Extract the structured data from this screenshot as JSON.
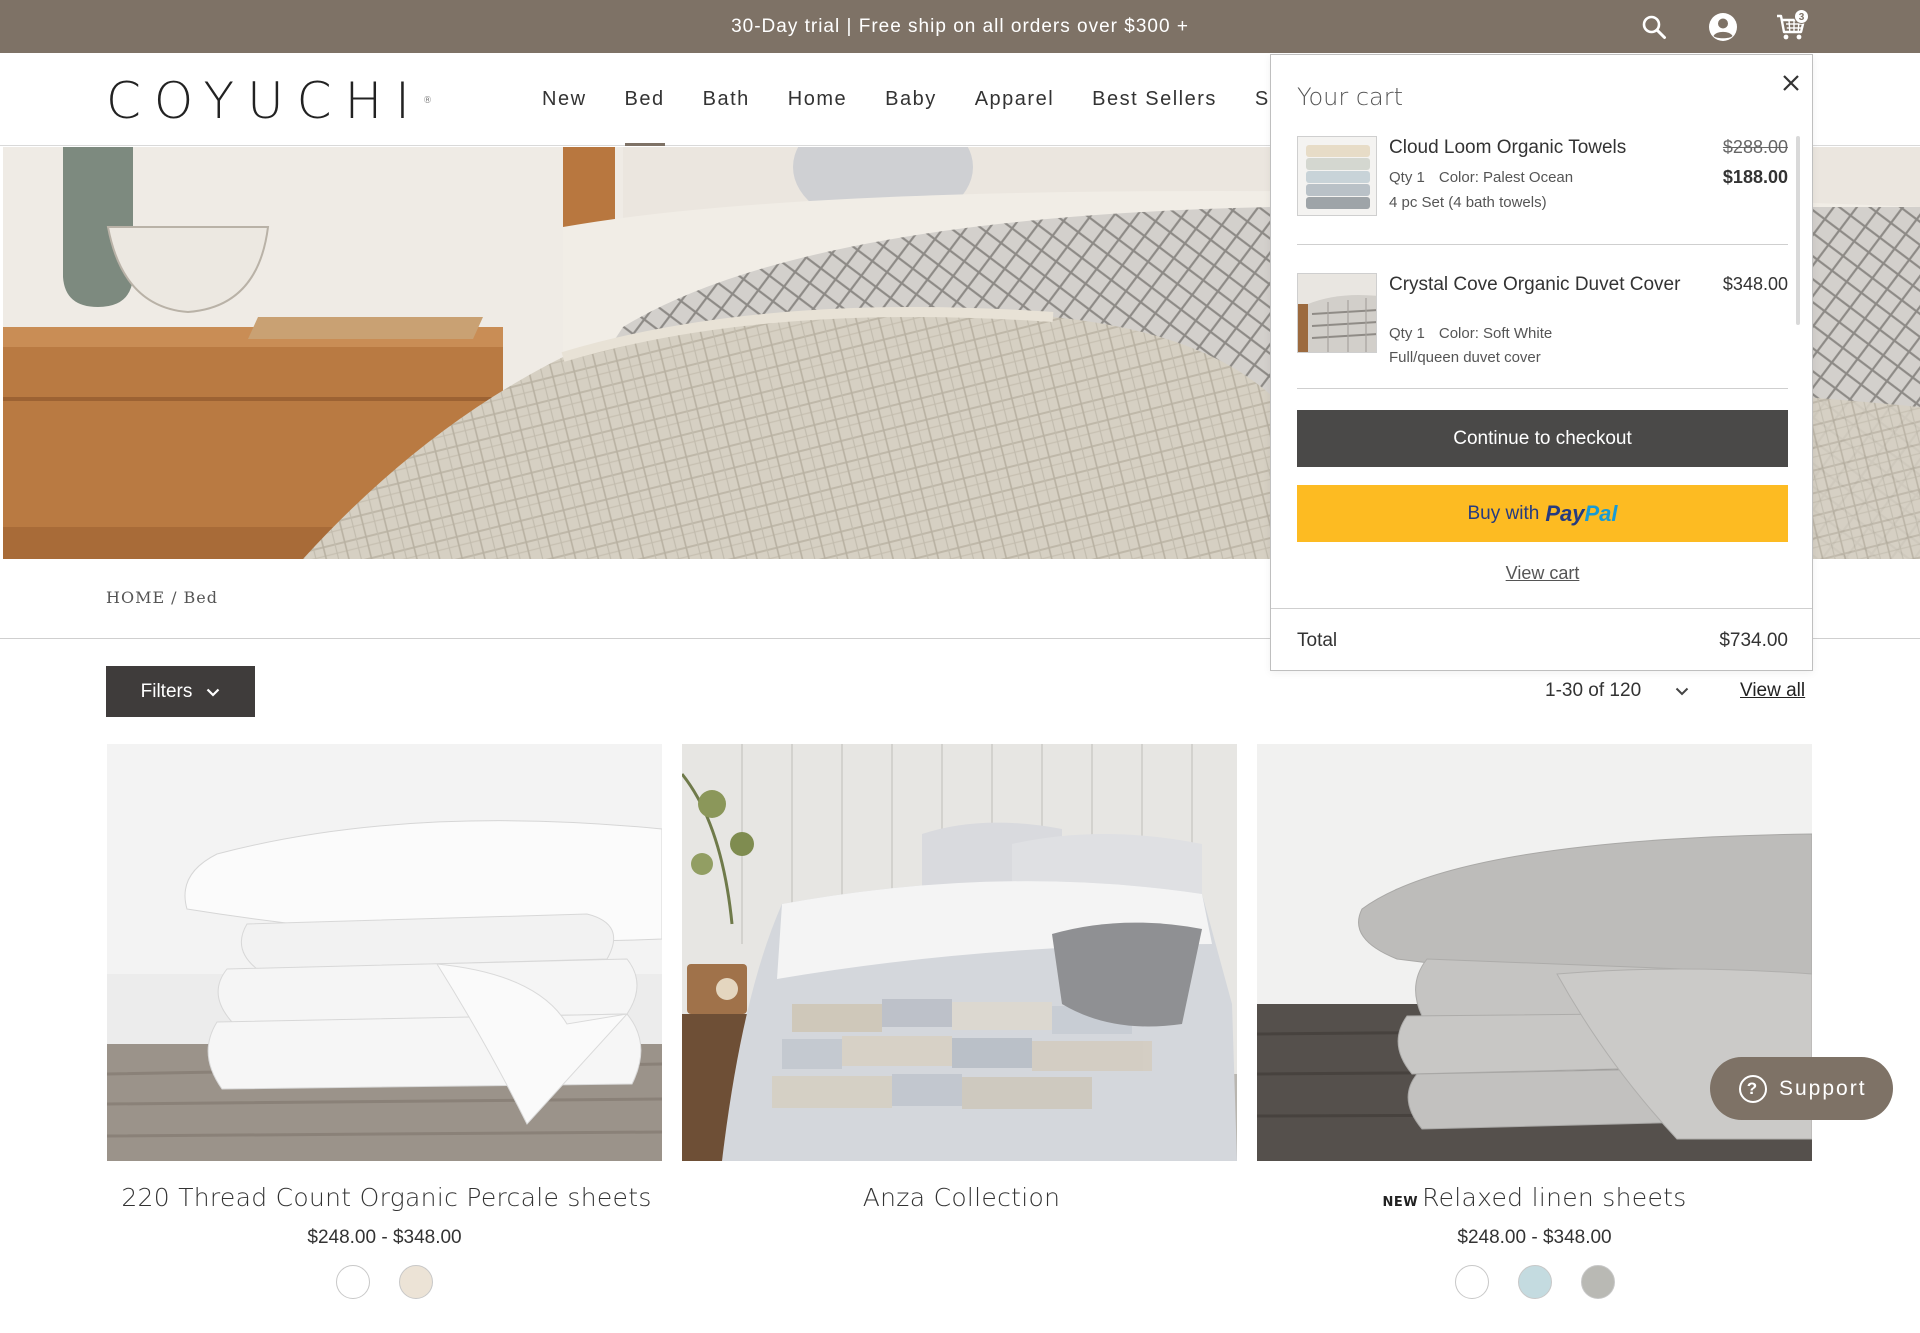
{
  "promo": {
    "text": "30-Day trial | Free ship on all orders over $300 +",
    "cart_count": "3",
    "background": "#7e7266"
  },
  "icons": {
    "search": "search-icon",
    "account": "account-icon",
    "cart": "cart-icon",
    "close": "close-icon",
    "chevron": "chevron-down-icon",
    "help": "help-icon"
  },
  "header": {
    "logo": "COYUCHI",
    "logo_mark": "®",
    "nav": [
      {
        "label": "New"
      },
      {
        "label": "Bed"
      },
      {
        "label": "Bath"
      },
      {
        "label": "Home"
      },
      {
        "label": "Baby"
      },
      {
        "label": "Apparel"
      },
      {
        "label": "Best Sellers"
      },
      {
        "label": "Sa"
      }
    ],
    "active_nav": "Bed"
  },
  "breadcrumb": {
    "home": "HOME",
    "sep": "/",
    "current": "Bed"
  },
  "toolbar": {
    "filters": "Filters",
    "pagination": "1-30 of 120",
    "view_all": "View all"
  },
  "products": [
    {
      "name": "220 Thread Count Organic Percale sheets",
      "badge": "",
      "price": "$248.00 - $348.00",
      "swatches": [
        "#ffffff",
        "#ece3d6"
      ]
    },
    {
      "name": "Anza Collection",
      "badge": "",
      "price": "",
      "swatches": []
    },
    {
      "name": "Relaxed linen sheets",
      "badge": "NEW",
      "price": "$248.00 - $348.00",
      "swatches": [
        "#ffffff",
        "#c4dbe0",
        "#b9b9b4"
      ]
    }
  ],
  "cart": {
    "title": "Your cart",
    "items": [
      {
        "name": "Cloud Loom Organic Towels",
        "qty": "Qty 1",
        "color": "Color: Palest Ocean",
        "variant": "4 pc Set (4 bath towels)",
        "price_old": "$288.00",
        "price": "$188.00"
      },
      {
        "name": "Crystal Cove Organic Duvet Cover",
        "qty": "Qty 1",
        "color": "Color: Soft White",
        "variant": "Full/queen duvet cover",
        "price": "$348.00"
      }
    ],
    "checkout": "Continue to checkout",
    "paypal_prefix": "Buy with",
    "paypal_pay": "Pay",
    "paypal_pal": "Pal",
    "view_cart": "View cart",
    "total_label": "Total",
    "total_value": "$734.00"
  },
  "support": {
    "label": "Support"
  }
}
